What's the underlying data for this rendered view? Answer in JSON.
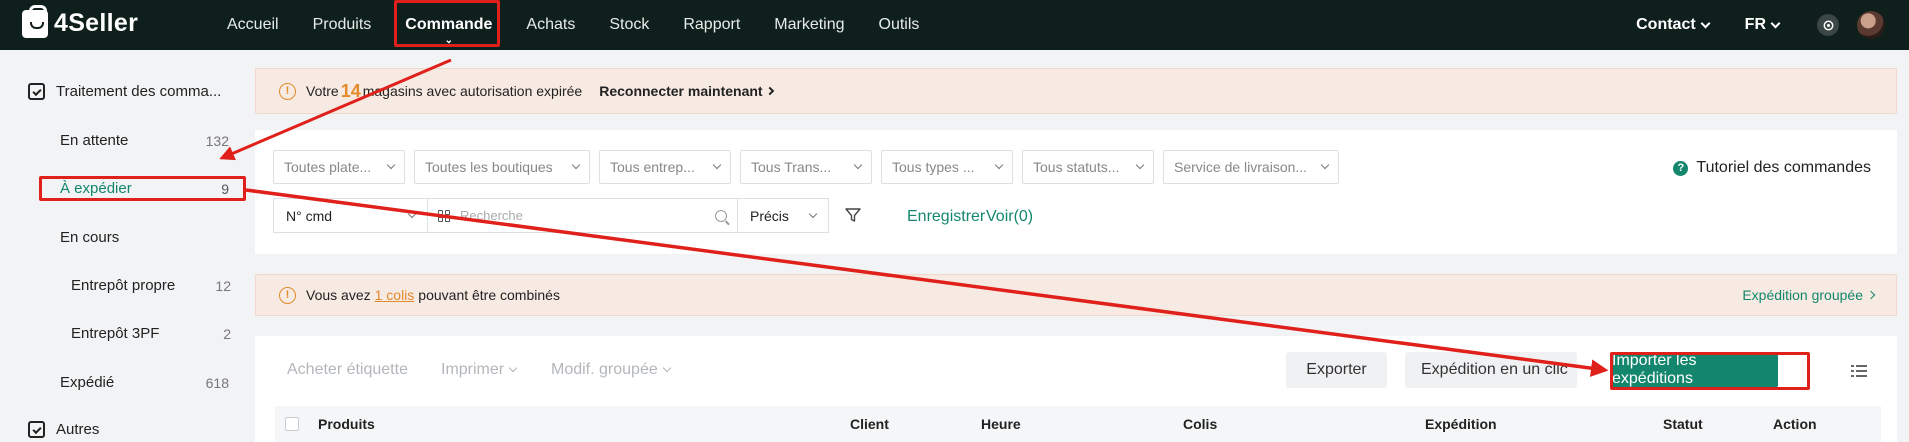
{
  "brand": {
    "name": "4Seller"
  },
  "nav": {
    "items": [
      {
        "label": "Accueil"
      },
      {
        "label": "Produits"
      },
      {
        "label": "Commande",
        "active": true
      },
      {
        "label": "Achats"
      },
      {
        "label": "Stock"
      },
      {
        "label": "Rapport"
      },
      {
        "label": "Marketing"
      },
      {
        "label": "Outils"
      }
    ],
    "contact": "Contact",
    "language": "FR"
  },
  "sidebar": {
    "group_title": "Traitement des comma...",
    "items": [
      {
        "label": "En attente",
        "count": "132"
      },
      {
        "label": "À expédier",
        "count": "9",
        "active": true
      },
      {
        "label": "En cours",
        "count": ""
      },
      {
        "label": "Entrepôt propre",
        "count": "12"
      },
      {
        "label": "Entrepôt 3PF",
        "count": "2"
      },
      {
        "label": "Expédié",
        "count": "618"
      }
    ],
    "group2_title": "Autres"
  },
  "auth_alert": {
    "prefix": "Votre",
    "count": "14",
    "suffix": "magasins avec autorisation expirée",
    "action": "Reconnecter maintenant"
  },
  "filters": {
    "selects": [
      "Toutes plate...",
      "Toutes les boutiques",
      "Tous entrep...",
      "Tous Trans...",
      "Tous types ...",
      "Tous statuts...",
      "Service de livraison..."
    ],
    "tutorial": "Tutoriel des commandes",
    "search_field": "N° cmd",
    "search_placeholder": "Recherche",
    "match_mode": "Précis",
    "save_label": "Enregistrer",
    "view_label": "Voir(0)"
  },
  "combine_alert": {
    "prefix": "Vous avez",
    "link": "1 colis",
    "suffix": "pouvant être combinés",
    "action": "Expédition groupée"
  },
  "toolbar": {
    "buy_label": "Acheter étiquette",
    "print_label": "Imprimer",
    "bulk_edit_label": "Modif. groupée",
    "export_label": "Exporter",
    "one_click_label": "Expédition en un clic",
    "import_label": "Importer les expéditions"
  },
  "table": {
    "columns": [
      "Produits",
      "Client",
      "Heure",
      "Colis",
      "Expédition",
      "Statut",
      "Action"
    ]
  },
  "colors": {
    "accent": "#14866d",
    "nav_bg": "#0f1f1c",
    "annotation": "#e0201a",
    "warning": "#e38a2b"
  }
}
